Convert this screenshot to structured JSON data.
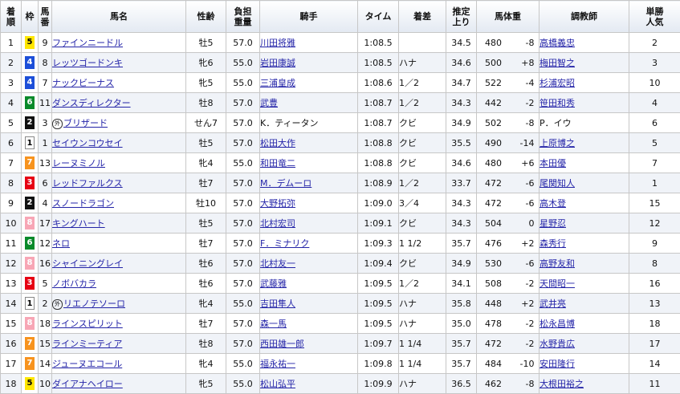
{
  "headers": {
    "rank": [
      "着",
      "順"
    ],
    "waku": "枠",
    "umaban": [
      "馬",
      "番"
    ],
    "name": "馬名",
    "sexage": "性齢",
    "weight": [
      "負担",
      "重量"
    ],
    "jockey": "騎手",
    "time": "タイム",
    "margin": "着差",
    "last3f": [
      "推定",
      "上り"
    ],
    "body": "馬体重",
    "trainer": "調教師",
    "pop": [
      "単勝",
      "人気"
    ]
  },
  "waku_colors": {
    "1": "#ffffff",
    "2": "#111111",
    "3": "#e60012",
    "4": "#1d4fd8",
    "5": "#ffe600",
    "6": "#0a8a2a",
    "7": "#f7931e",
    "8": "#f7a6b5"
  },
  "link_color": "#2424a8",
  "rows": [
    {
      "rank": "1",
      "waku": "5",
      "umaban": "9",
      "mark": "",
      "name": "ファインニードル",
      "sexage": "牡5",
      "weight": "57.0",
      "jockey": "川田将雅",
      "jockey_link": true,
      "time": "1:08.5",
      "margin": "",
      "last3f": "34.5",
      "body": "480",
      "diff": "-8",
      "trainer": "高橋義忠",
      "trainer_link": true,
      "pop": "2"
    },
    {
      "rank": "2",
      "waku": "4",
      "umaban": "8",
      "mark": "",
      "name": "レッツゴードンキ",
      "sexage": "牝6",
      "weight": "55.0",
      "jockey": "岩田康誠",
      "jockey_link": true,
      "time": "1:08.5",
      "margin": "ハナ",
      "last3f": "34.6",
      "body": "500",
      "diff": "+8",
      "trainer": "梅田智之",
      "trainer_link": true,
      "pop": "3"
    },
    {
      "rank": "3",
      "waku": "4",
      "umaban": "7",
      "mark": "",
      "name": "ナックビーナス",
      "sexage": "牝5",
      "weight": "55.0",
      "jockey": "三浦皇成",
      "jockey_link": true,
      "time": "1:08.6",
      "margin": "1／2",
      "last3f": "34.7",
      "body": "522",
      "diff": "-4",
      "trainer": "杉浦宏昭",
      "trainer_link": true,
      "pop": "10"
    },
    {
      "rank": "4",
      "waku": "6",
      "umaban": "11",
      "mark": "",
      "name": "ダンスディレクター",
      "sexage": "牡8",
      "weight": "57.0",
      "jockey": "武豊",
      "jockey_link": true,
      "time": "1:08.7",
      "margin": "1／2",
      "last3f": "34.3",
      "body": "442",
      "diff": "-2",
      "trainer": "笹田和秀",
      "trainer_link": true,
      "pop": "4"
    },
    {
      "rank": "5",
      "waku": "2",
      "umaban": "3",
      "mark": "外",
      "name": "ブリザード",
      "sexage": "せん7",
      "weight": "57.0",
      "jockey": "K．ティータン",
      "jockey_link": false,
      "time": "1:08.7",
      "margin": "クビ",
      "last3f": "34.9",
      "body": "502",
      "diff": "-8",
      "trainer": "P．イウ",
      "trainer_link": false,
      "pop": "6"
    },
    {
      "rank": "6",
      "waku": "1",
      "umaban": "1",
      "mark": "",
      "name": "セイウンコウセイ",
      "sexage": "牡5",
      "weight": "57.0",
      "jockey": "松田大作",
      "jockey_link": true,
      "time": "1:08.8",
      "margin": "クビ",
      "last3f": "35.5",
      "body": "490",
      "diff": "-14",
      "trainer": "上原博之",
      "trainer_link": true,
      "pop": "5"
    },
    {
      "rank": "7",
      "waku": "7",
      "umaban": "13",
      "mark": "",
      "name": "レーヌミノル",
      "sexage": "牝4",
      "weight": "55.0",
      "jockey": "和田竜二",
      "jockey_link": true,
      "time": "1:08.8",
      "margin": "クビ",
      "last3f": "34.6",
      "body": "480",
      "diff": "+6",
      "trainer": "本田優",
      "trainer_link": true,
      "pop": "7"
    },
    {
      "rank": "8",
      "waku": "3",
      "umaban": "6",
      "mark": "",
      "name": "レッドファルクス",
      "sexage": "牡7",
      "weight": "57.0",
      "jockey": "M．デムーロ",
      "jockey_link": true,
      "time": "1:08.9",
      "margin": "1／2",
      "last3f": "33.7",
      "body": "472",
      "diff": "-6",
      "trainer": "尾関知人",
      "trainer_link": true,
      "pop": "1"
    },
    {
      "rank": "9",
      "waku": "2",
      "umaban": "4",
      "mark": "",
      "name": "スノードラゴン",
      "sexage": "牡10",
      "weight": "57.0",
      "jockey": "大野拓弥",
      "jockey_link": true,
      "time": "1:09.0",
      "margin": "3／4",
      "last3f": "34.3",
      "body": "472",
      "diff": "-6",
      "trainer": "高木登",
      "trainer_link": true,
      "pop": "15"
    },
    {
      "rank": "10",
      "waku": "8",
      "umaban": "17",
      "mark": "",
      "name": "キングハート",
      "sexage": "牡5",
      "weight": "57.0",
      "jockey": "北村宏司",
      "jockey_link": true,
      "time": "1:09.1",
      "margin": "クビ",
      "last3f": "34.3",
      "body": "504",
      "diff": "0",
      "trainer": "星野忍",
      "trainer_link": true,
      "pop": "12"
    },
    {
      "rank": "11",
      "waku": "6",
      "umaban": "12",
      "mark": "",
      "name": "ネロ",
      "sexage": "牡7",
      "weight": "57.0",
      "jockey": "F．ミナリク",
      "jockey_link": true,
      "time": "1:09.3",
      "margin": "1 1/2",
      "last3f": "35.7",
      "body": "476",
      "diff": "+2",
      "trainer": "森秀行",
      "trainer_link": true,
      "pop": "9"
    },
    {
      "rank": "12",
      "waku": "8",
      "umaban": "16",
      "mark": "",
      "name": "シャイニングレイ",
      "sexage": "牡6",
      "weight": "57.0",
      "jockey": "北村友一",
      "jockey_link": true,
      "time": "1:09.4",
      "margin": "クビ",
      "last3f": "34.9",
      "body": "530",
      "diff": "-6",
      "trainer": "高野友和",
      "trainer_link": true,
      "pop": "8"
    },
    {
      "rank": "13",
      "waku": "3",
      "umaban": "5",
      "mark": "",
      "name": "ノボバカラ",
      "sexage": "牡6",
      "weight": "57.0",
      "jockey": "武藤雅",
      "jockey_link": true,
      "time": "1:09.5",
      "margin": "1／2",
      "last3f": "34.1",
      "body": "508",
      "diff": "-2",
      "trainer": "天間昭一",
      "trainer_link": true,
      "pop": "16"
    },
    {
      "rank": "14",
      "waku": "1",
      "umaban": "2",
      "mark": "外",
      "name": "リエノテソーロ",
      "sexage": "牝4",
      "weight": "55.0",
      "jockey": "吉田隼人",
      "jockey_link": true,
      "time": "1:09.5",
      "margin": "ハナ",
      "last3f": "35.8",
      "body": "448",
      "diff": "+2",
      "trainer": "武井亮",
      "trainer_link": true,
      "pop": "13"
    },
    {
      "rank": "15",
      "waku": "8",
      "umaban": "18",
      "mark": "",
      "name": "ラインスピリット",
      "sexage": "牡7",
      "weight": "57.0",
      "jockey": "森一馬",
      "jockey_link": true,
      "time": "1:09.5",
      "margin": "ハナ",
      "last3f": "35.0",
      "body": "478",
      "diff": "-2",
      "trainer": "松永昌博",
      "trainer_link": true,
      "pop": "18"
    },
    {
      "rank": "16",
      "waku": "7",
      "umaban": "15",
      "mark": "",
      "name": "ラインミーティア",
      "sexage": "牡8",
      "weight": "57.0",
      "jockey": "西田雄一郎",
      "jockey_link": true,
      "time": "1:09.7",
      "margin": "1 1/4",
      "last3f": "35.7",
      "body": "472",
      "diff": "-2",
      "trainer": "水野貴広",
      "trainer_link": true,
      "pop": "17"
    },
    {
      "rank": "17",
      "waku": "7",
      "umaban": "14",
      "mark": "",
      "name": "ジューヌエコール",
      "sexage": "牝4",
      "weight": "55.0",
      "jockey": "福永祐一",
      "jockey_link": true,
      "time": "1:09.8",
      "margin": "1 1/4",
      "last3f": "35.7",
      "body": "484",
      "diff": "-10",
      "trainer": "安田隆行",
      "trainer_link": true,
      "pop": "14"
    },
    {
      "rank": "18",
      "waku": "5",
      "umaban": "10",
      "mark": "",
      "name": "ダイアナヘイロー",
      "sexage": "牝5",
      "weight": "55.0",
      "jockey": "松山弘平",
      "jockey_link": true,
      "time": "1:09.9",
      "margin": "ハナ",
      "last3f": "36.5",
      "body": "462",
      "diff": "-8",
      "trainer": "大根田裕之",
      "trainer_link": true,
      "pop": "11"
    }
  ]
}
